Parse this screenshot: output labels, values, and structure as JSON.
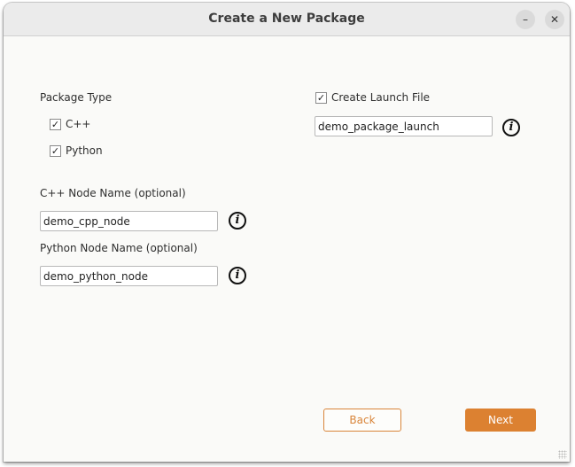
{
  "window": {
    "title": "Create a New Package",
    "minimize_icon": "minimize-icon",
    "close_icon": "close-icon",
    "minimize_glyph": "–",
    "close_glyph": "✕"
  },
  "package_type": {
    "label": "Package Type",
    "options": [
      {
        "label": "C++",
        "checked": true
      },
      {
        "label": "Python",
        "checked": true
      }
    ]
  },
  "check_glyph": "✓",
  "launch": {
    "checkbox_label": "Create Launch File",
    "checked": true,
    "value": "demo_package_launch"
  },
  "cpp_node": {
    "label": "C++ Node Name (optional)",
    "value": "demo_cpp_node"
  },
  "python_node": {
    "label": "Python Node Name (optional)",
    "value": "demo_python_node"
  },
  "info_glyph": "i",
  "buttons": {
    "back": "Back",
    "next": "Next"
  },
  "colors": {
    "accent": "#dc8131"
  }
}
